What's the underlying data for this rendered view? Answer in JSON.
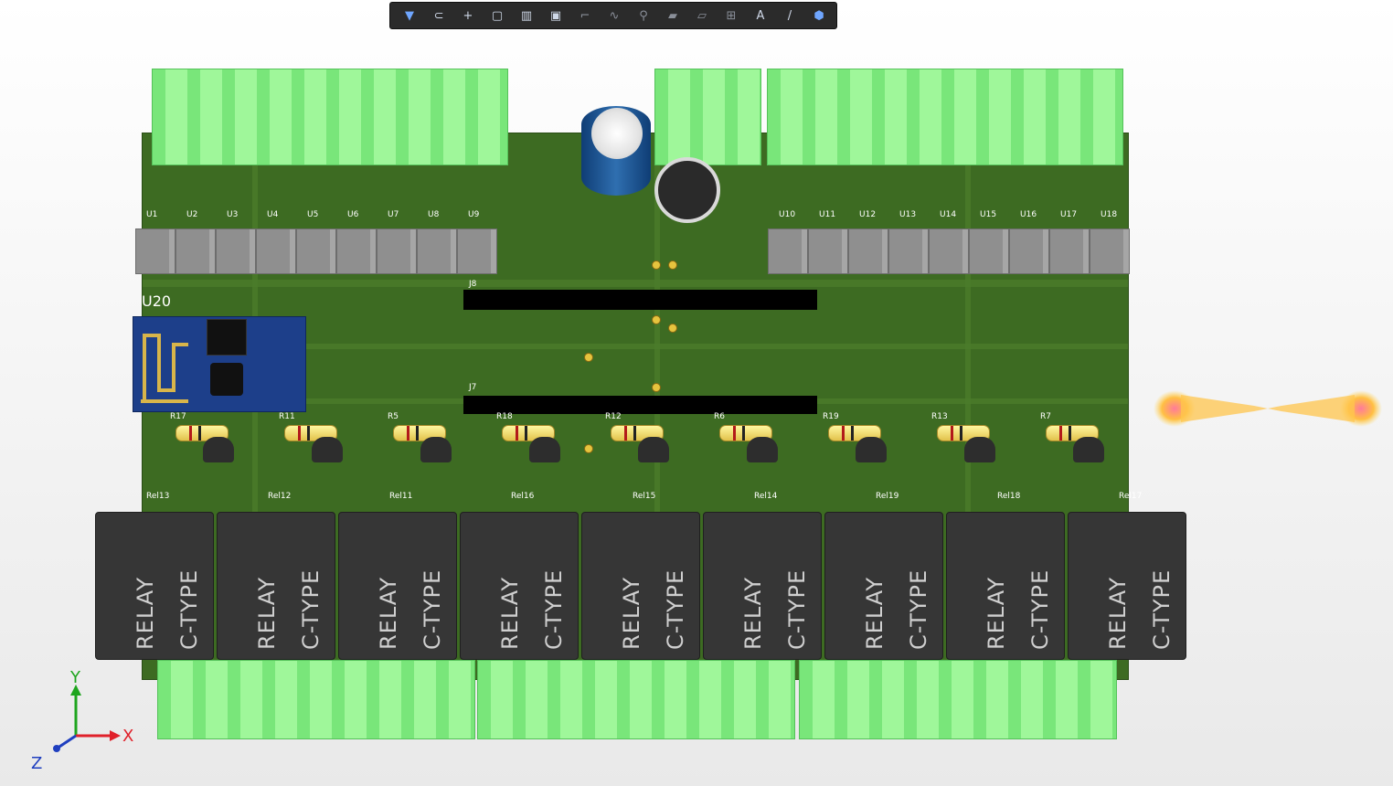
{
  "toolbar": {
    "buttons": [
      {
        "name": "filter-icon",
        "glyph": "▼"
      },
      {
        "name": "magnet-icon",
        "glyph": "⊂"
      },
      {
        "name": "add-icon",
        "glyph": "+"
      },
      {
        "name": "select-box-icon",
        "glyph": "▢"
      },
      {
        "name": "chart-icon",
        "glyph": "▥"
      },
      {
        "name": "chip-icon",
        "glyph": "▣"
      },
      {
        "name": "route-icon",
        "glyph": "⌐"
      },
      {
        "name": "wave-icon",
        "glyph": "∿"
      },
      {
        "name": "pin-icon",
        "glyph": "⚲"
      },
      {
        "name": "layers-icon",
        "glyph": "▰"
      },
      {
        "name": "board-icon",
        "glyph": "▱"
      },
      {
        "name": "measure-icon",
        "glyph": "⊞"
      },
      {
        "name": "text-icon",
        "glyph": "A"
      },
      {
        "name": "line-icon",
        "glyph": "/"
      },
      {
        "name": "view-icon",
        "glyph": "⬢"
      }
    ]
  },
  "pcb": {
    "labels": {
      "u20": "U20",
      "j7": "J7",
      "j8": "J8"
    },
    "optos_left": [
      "U1",
      "U2",
      "U3",
      "U4",
      "U5",
      "U6",
      "U7",
      "U8",
      "U9"
    ],
    "optos_right": [
      "U10",
      "U11",
      "U12",
      "U13",
      "U14",
      "U15",
      "U16",
      "U17",
      "U18"
    ],
    "resistors": [
      "R17",
      "R11",
      "R5",
      "R18",
      "R12",
      "R6",
      "R19",
      "R13",
      "R7"
    ],
    "relays": [
      {
        "label": "Rel13",
        "line1": "RELAY",
        "line2": "C-TYPE"
      },
      {
        "label": "Rel12",
        "line1": "RELAY",
        "line2": "C-TYPE"
      },
      {
        "label": "Rel11",
        "line1": "RELAY",
        "line2": "C-TYPE"
      },
      {
        "label": "Rel16",
        "line1": "RELAY",
        "line2": "C-TYPE"
      },
      {
        "label": "Rel15",
        "line1": "RELAY",
        "line2": "C-TYPE"
      },
      {
        "label": "Rel14",
        "line1": "RELAY",
        "line2": "C-TYPE"
      },
      {
        "label": "Rel19",
        "line1": "RELAY",
        "line2": "C-TYPE"
      },
      {
        "label": "Rel18",
        "line1": "RELAY",
        "line2": "C-TYPE"
      },
      {
        "label": "Rel17",
        "line1": "RELAY",
        "line2": "C-TYPE"
      }
    ]
  },
  "axes": {
    "x": "X",
    "y": "Y",
    "z": "Z",
    "x_color": "#e0202a",
    "y_color": "#1ea51e",
    "z_color": "#1f3fbf"
  }
}
